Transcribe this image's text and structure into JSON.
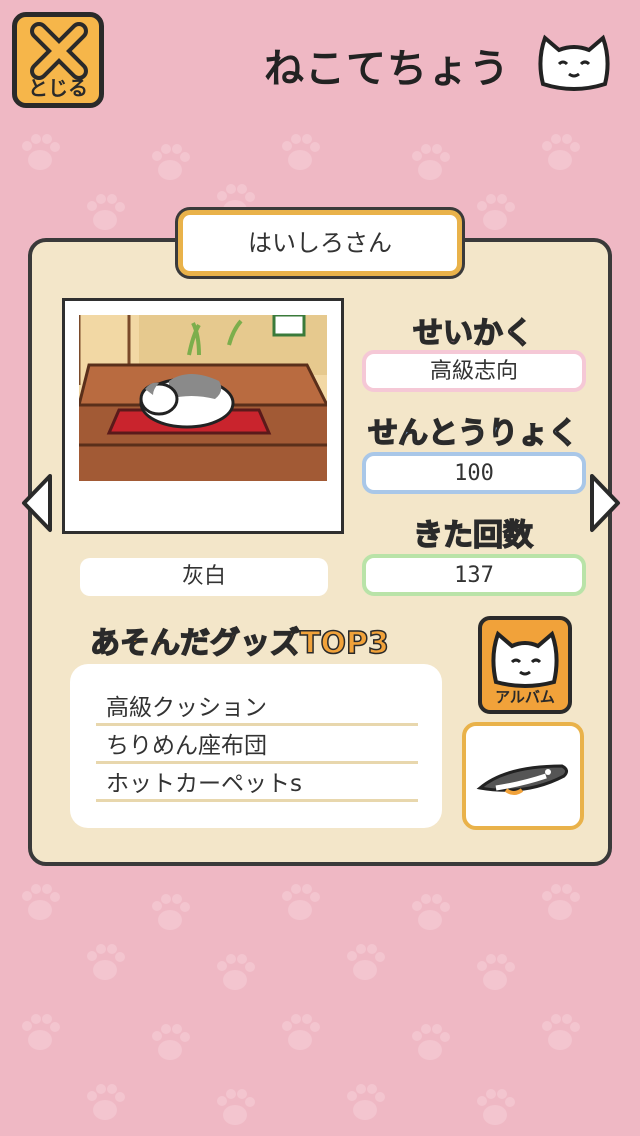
{
  "header": {
    "close_label": "とじる",
    "title": "ねこてちょう"
  },
  "cat": {
    "name": "はいしろさん",
    "fur": "灰白"
  },
  "stats": {
    "personality_label": "せいかく",
    "personality_value": "高級志向",
    "power_label": "せんとうりょく",
    "power_value": "100",
    "visits_label": "きた回数",
    "visits_value": "137"
  },
  "goods": {
    "heading": "あそんだグッズTOP3",
    "items": [
      "高級クッション",
      "ちりめん座布団",
      "ホットカーペットs"
    ]
  },
  "album": {
    "label": "アルバム"
  },
  "colors": {
    "background": "#efb8c4",
    "panel": "#f3e6c9",
    "accent_orange": "#f1a23a",
    "personality_border": "#f5c8d6",
    "power_border": "#a9c7e8",
    "visits_border": "#b9e3a8"
  }
}
